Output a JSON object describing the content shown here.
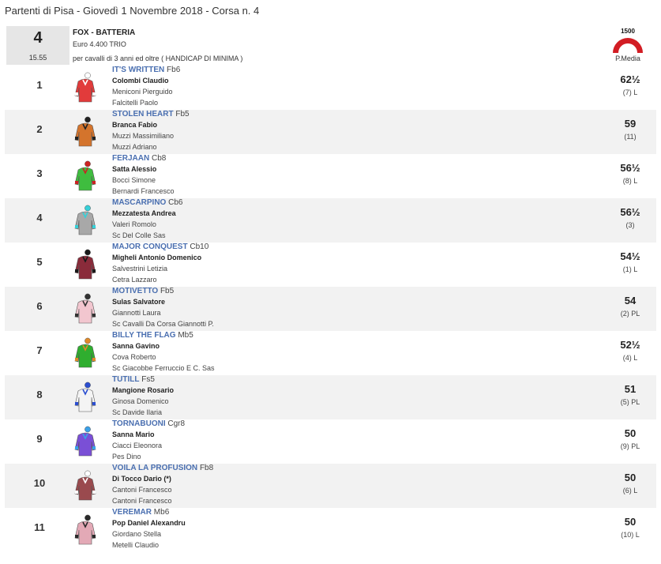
{
  "page": {
    "title": "Partenti di Pisa - Giovedì 1 Novembre 2018 - Corsa n. 4"
  },
  "race": {
    "number": "4",
    "time": "15.55",
    "name": "FOX - BATTERIA",
    "prize": "Euro 4.400 TRIO",
    "conditions": "per cavalli di 3 anni ed oltre ( HANDICAP DI MINIMA )",
    "distance_badge": "1500",
    "avg_label": "P.Media"
  },
  "runners": [
    {
      "num": "1",
      "horse": "IT'S WRITTEN",
      "age": "Fb6",
      "jockey": "Colombi Claudio",
      "trainer": "Meniconi Pierguido",
      "owner": "Falcitelli Paolo",
      "weight": "62½",
      "extra": "(7) L",
      "silk_icon": "jockey-silk-icon",
      "silk_colors": [
        "#e23b3b",
        "#ffffff"
      ]
    },
    {
      "num": "2",
      "horse": "STOLEN HEART",
      "age": "Fb5",
      "jockey": "Branca Fabio",
      "trainer": "Muzzi Massimiliano",
      "owner": "Muzzi Adriano",
      "weight": "59",
      "extra": "(11)",
      "silk_icon": "jockey-silk-icon",
      "silk_colors": [
        "#d4742c",
        "#222222"
      ]
    },
    {
      "num": "3",
      "horse": "FERJAAN",
      "age": "Cb8",
      "jockey": "Satta Alessio",
      "trainer": "Bocci Simone",
      "owner": "Bernardi Francesco",
      "weight": "56½",
      "extra": "(8) L",
      "silk_icon": "jockey-silk-icon",
      "silk_colors": [
        "#3fbd3f",
        "#cc2222"
      ]
    },
    {
      "num": "4",
      "horse": "MASCARPINO",
      "age": "Cb6",
      "jockey": "Mezzatesta Andrea",
      "trainer": "Valeri Romolo",
      "owner": "Sc Del Colle Sas",
      "weight": "56½",
      "extra": "(3)",
      "silk_icon": "jockey-silk-icon",
      "silk_colors": [
        "#a8a8a8",
        "#36d0d8"
      ]
    },
    {
      "num": "5",
      "horse": "MAJOR CONQUEST",
      "age": "Cb10",
      "jockey": "Migheli Antonio Domenico",
      "trainer": "Salvestrini Letizia",
      "owner": "Cetra Lazzaro",
      "weight": "54½",
      "extra": "(1) L",
      "silk_icon": "jockey-silk-icon",
      "silk_colors": [
        "#8a2b3a",
        "#1a1a1a"
      ]
    },
    {
      "num": "6",
      "horse": "MOTIVETTO",
      "age": "Fb5",
      "jockey": "Sulas Salvatore",
      "trainer": "Giannotti Laura",
      "owner": "Sc Cavalli Da Corsa Giannotti P.",
      "weight": "54",
      "extra": "(2) PL",
      "silk_icon": "jockey-silk-icon",
      "silk_colors": [
        "#f2c6cf",
        "#333333"
      ]
    },
    {
      "num": "7",
      "horse": "BILLY THE FLAG",
      "age": "Mb5",
      "jockey": "Sanna Gavino",
      "trainer": "Cova Roberto",
      "owner": "Sc Giacobbe Ferruccio E C. Sas",
      "weight": "52½",
      "extra": "(4) L",
      "silk_icon": "jockey-silk-icon",
      "silk_colors": [
        "#2fae2f",
        "#e08a2a"
      ]
    },
    {
      "num": "8",
      "horse": "TUTILL",
      "age": "Fs5",
      "jockey": "Mangione Rosario",
      "trainer": "Ginosa Domenico",
      "owner": "Sc Davide Ilaria",
      "weight": "51",
      "extra": "(5) PL",
      "silk_icon": "jockey-silk-icon",
      "silk_colors": [
        "#f4f4f4",
        "#2b4ed0"
      ]
    },
    {
      "num": "9",
      "horse": "TORNABUONI",
      "age": "Cgr8",
      "jockey": "Sanna Mario",
      "trainer": "Ciacci Eleonora",
      "owner": "Pes Dino",
      "weight": "50",
      "extra": "(9) PL",
      "silk_icon": "jockey-silk-icon",
      "silk_colors": [
        "#7a4fd6",
        "#3aa0e8"
      ]
    },
    {
      "num": "10",
      "horse": "VOILA LA PROFUSION",
      "age": "Fb8",
      "jockey": "Di Tocco Dario (*)",
      "trainer": "Cantoni Francesco",
      "owner": "Cantoni Francesco",
      "weight": "50",
      "extra": "(6) L",
      "silk_icon": "jockey-silk-icon",
      "silk_colors": [
        "#9a4a4e",
        "#ffffff"
      ]
    },
    {
      "num": "11",
      "horse": "VEREMAR",
      "age": "Mb6",
      "jockey": "Pop Daniel Alexandru",
      "trainer": "Giordano Stella",
      "owner": "Metelli Claudio",
      "weight": "50",
      "extra": "(10) L",
      "silk_icon": "jockey-silk-icon",
      "silk_colors": [
        "#e3a9b6",
        "#2a2a2a"
      ]
    }
  ]
}
